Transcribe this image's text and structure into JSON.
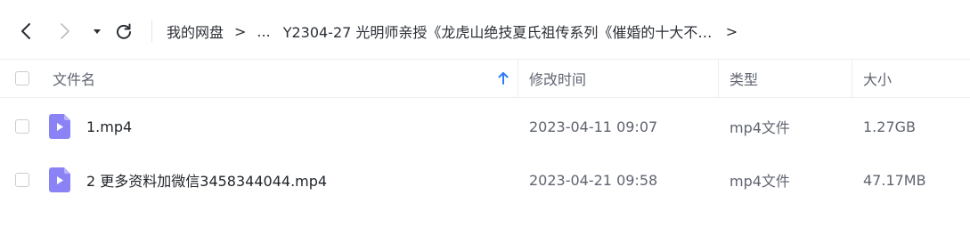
{
  "nav": {
    "back_icon": "chevron-left-icon",
    "forward_icon": "chevron-right-icon",
    "dropdown_icon": "caret-down-icon",
    "refresh_icon": "refresh-icon"
  },
  "breadcrumb": {
    "root": "我的网盘",
    "separator": ">",
    "ellipsis": "...",
    "current": "Y2304-27 光明师亲授《龙虎山绝技夏氏祖传系列《催婚的十大不传之秘...",
    "trailing_separator": ">"
  },
  "table": {
    "headers": {
      "name": "文件名",
      "modified": "修改时间",
      "type": "类型",
      "size": "大小"
    },
    "sort": {
      "column": "name",
      "direction": "ascending",
      "icon": "arrow-up-icon",
      "color": "#2c7bf6"
    },
    "rows": [
      {
        "name": "1.mp4",
        "modified": "2023-04-11 09:07",
        "type": "mp4文件",
        "size": "1.27GB",
        "icon": "video-file-icon"
      },
      {
        "name": "2 更多资料加微信3458344044.mp4",
        "modified": "2023-04-21 09:58",
        "type": "mp4文件",
        "size": "47.17MB",
        "icon": "video-file-icon"
      }
    ]
  },
  "colors": {
    "file_icon": "#8b83f5",
    "file_icon_fold": "#b8b3fa",
    "accent": "#2c7bf6"
  }
}
